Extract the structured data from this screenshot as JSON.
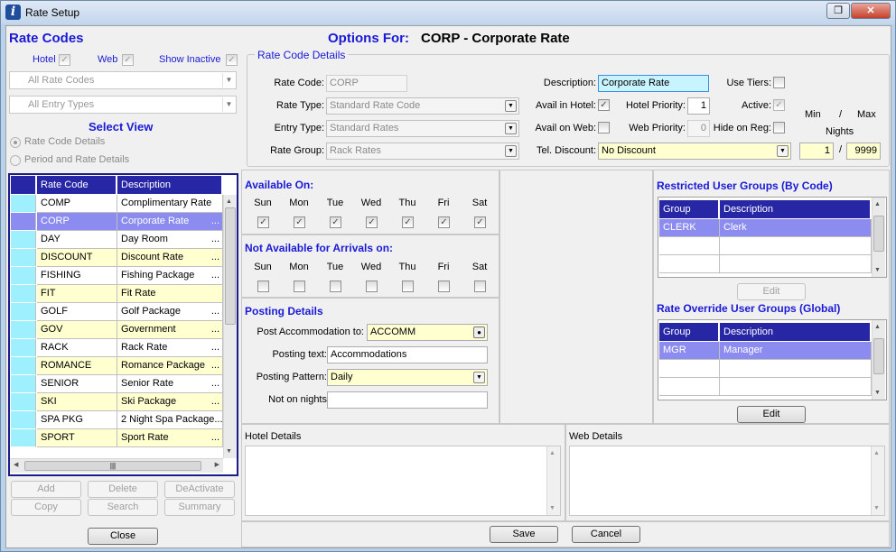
{
  "window": {
    "title": "Rate Setup",
    "controls": [
      "restore",
      "close"
    ]
  },
  "left": {
    "heading": "Rate Codes",
    "filters": {
      "hotel": "Hotel",
      "web": "Web",
      "show_inactive": "Show Inactive"
    },
    "rate_codes_combo": "All Rate Codes",
    "entry_types_combo": "All Entry Types",
    "select_view": "Select View",
    "views": [
      "Rate Code Details",
      "Period and Rate Details"
    ],
    "grid": {
      "headers": [
        "Rate Code",
        "Description"
      ],
      "rows": [
        {
          "code": "COMP",
          "desc": "Complimentary Rate",
          "more": ""
        },
        {
          "code": "CORP",
          "desc": "Corporate Rate",
          "more": "..."
        },
        {
          "code": "DAY",
          "desc": "Day Room",
          "more": "..."
        },
        {
          "code": "DISCOUNT",
          "desc": "Discount Rate",
          "more": "..."
        },
        {
          "code": "FISHING",
          "desc": "Fishing Package",
          "more": "..."
        },
        {
          "code": "FIT",
          "desc": "Fit Rate",
          "more": ""
        },
        {
          "code": "GOLF",
          "desc": "Golf Package",
          "more": "..."
        },
        {
          "code": "GOV",
          "desc": "Government",
          "more": "..."
        },
        {
          "code": "RACK",
          "desc": "Rack Rate",
          "more": "..."
        },
        {
          "code": "ROMANCE",
          "desc": "Romance Package",
          "more": "..."
        },
        {
          "code": "SENIOR",
          "desc": "Senior Rate",
          "more": "..."
        },
        {
          "code": "SKI",
          "desc": "Ski Package",
          "more": "..."
        },
        {
          "code": "SPA PKG",
          "desc": "2 Night Spa Package...",
          "more": ""
        },
        {
          "code": "SPORT",
          "desc": "Sport Rate",
          "more": "..."
        }
      ]
    },
    "buttons": [
      "Add",
      "Delete",
      "DeActivate",
      "Copy",
      "Search",
      "Summary"
    ],
    "close": "Close"
  },
  "main": {
    "options_label": "Options For:",
    "options_value": "CORP - Corporate Rate",
    "details_legend": "Rate Code Details",
    "rate_code_label": "Rate Code:",
    "rate_code": "CORP",
    "rate_type_label": "Rate Type:",
    "rate_type": "Standard Rate Code",
    "entry_type_label": "Entry Type:",
    "entry_type": "Standard Rates",
    "rate_group_label": "Rate Group:",
    "rate_group": "Rack Rates",
    "description_label": "Description:",
    "description": "Corporate Rate",
    "avail_hotel_label": "Avail in Hotel:",
    "avail_web_label": "Avail on Web:",
    "hotel_priority_label": "Hotel Priority:",
    "hotel_priority": "1",
    "web_priority_label": "Web Priority:",
    "web_priority": "0",
    "use_tiers_label": "Use Tiers:",
    "active_label": "Active:",
    "hide_on_reg_label": "Hide on Reg:",
    "tel_discount_label": "Tel. Discount:",
    "tel_discount": "No Discount",
    "min_label": "Min",
    "slash": "/",
    "max_label": "Max",
    "nights_label": "Nights",
    "min_value": "1",
    "max_value": "9999",
    "available_on": "Available On:",
    "not_available": "Not Available for Arrivals on:",
    "days": [
      "Sun",
      "Mon",
      "Tue",
      "Wed",
      "Thu",
      "Fri",
      "Sat"
    ],
    "posting": {
      "heading": "Posting Details",
      "post_accom_label": "Post Accommodation to:",
      "post_accom": "ACCOMM",
      "posting_text_label": "Posting text:",
      "posting_text": "Accommodations",
      "pattern_label": "Posting Pattern:",
      "pattern": "Daily",
      "not_nights_label": "Not on nights",
      "not_nights": ""
    },
    "restricted": {
      "heading": "Restricted User Groups (By Code)",
      "headers": [
        "Group",
        "Description"
      ],
      "rows": [
        {
          "group": "CLERK",
          "desc": "Clerk"
        }
      ],
      "edit": "Edit"
    },
    "override": {
      "heading": "Rate Override User Groups (Global)",
      "headers": [
        "Group",
        "Description"
      ],
      "rows": [
        {
          "group": "MGR",
          "desc": "Manager"
        }
      ],
      "edit": "Edit"
    },
    "hotel_details": "Hotel Details",
    "web_details": "Web Details",
    "save": "Save",
    "cancel": "Cancel"
  },
  "colors": {
    "accent": "#1a1ad6",
    "header": "#2727a6",
    "selected": "#8c8cf0",
    "yellow": "#ffffd0",
    "cyan": "#9ff0ff"
  }
}
